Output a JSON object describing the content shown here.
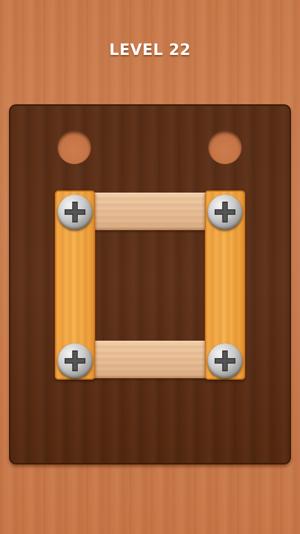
{
  "level": {
    "title": "LEVEL 22"
  },
  "board": {
    "holes": 2,
    "screws": 4,
    "planks": {
      "horizontal": 2,
      "vertical": 2
    }
  },
  "colors": {
    "background_wood": "#c9794a",
    "board_wood": "#5b2f16",
    "light_plank": "#eac19a",
    "orange_plank": "#f7b552",
    "screw_metal": "#c9c9c9"
  },
  "icons": {
    "screw": "phillips-screw-icon"
  }
}
